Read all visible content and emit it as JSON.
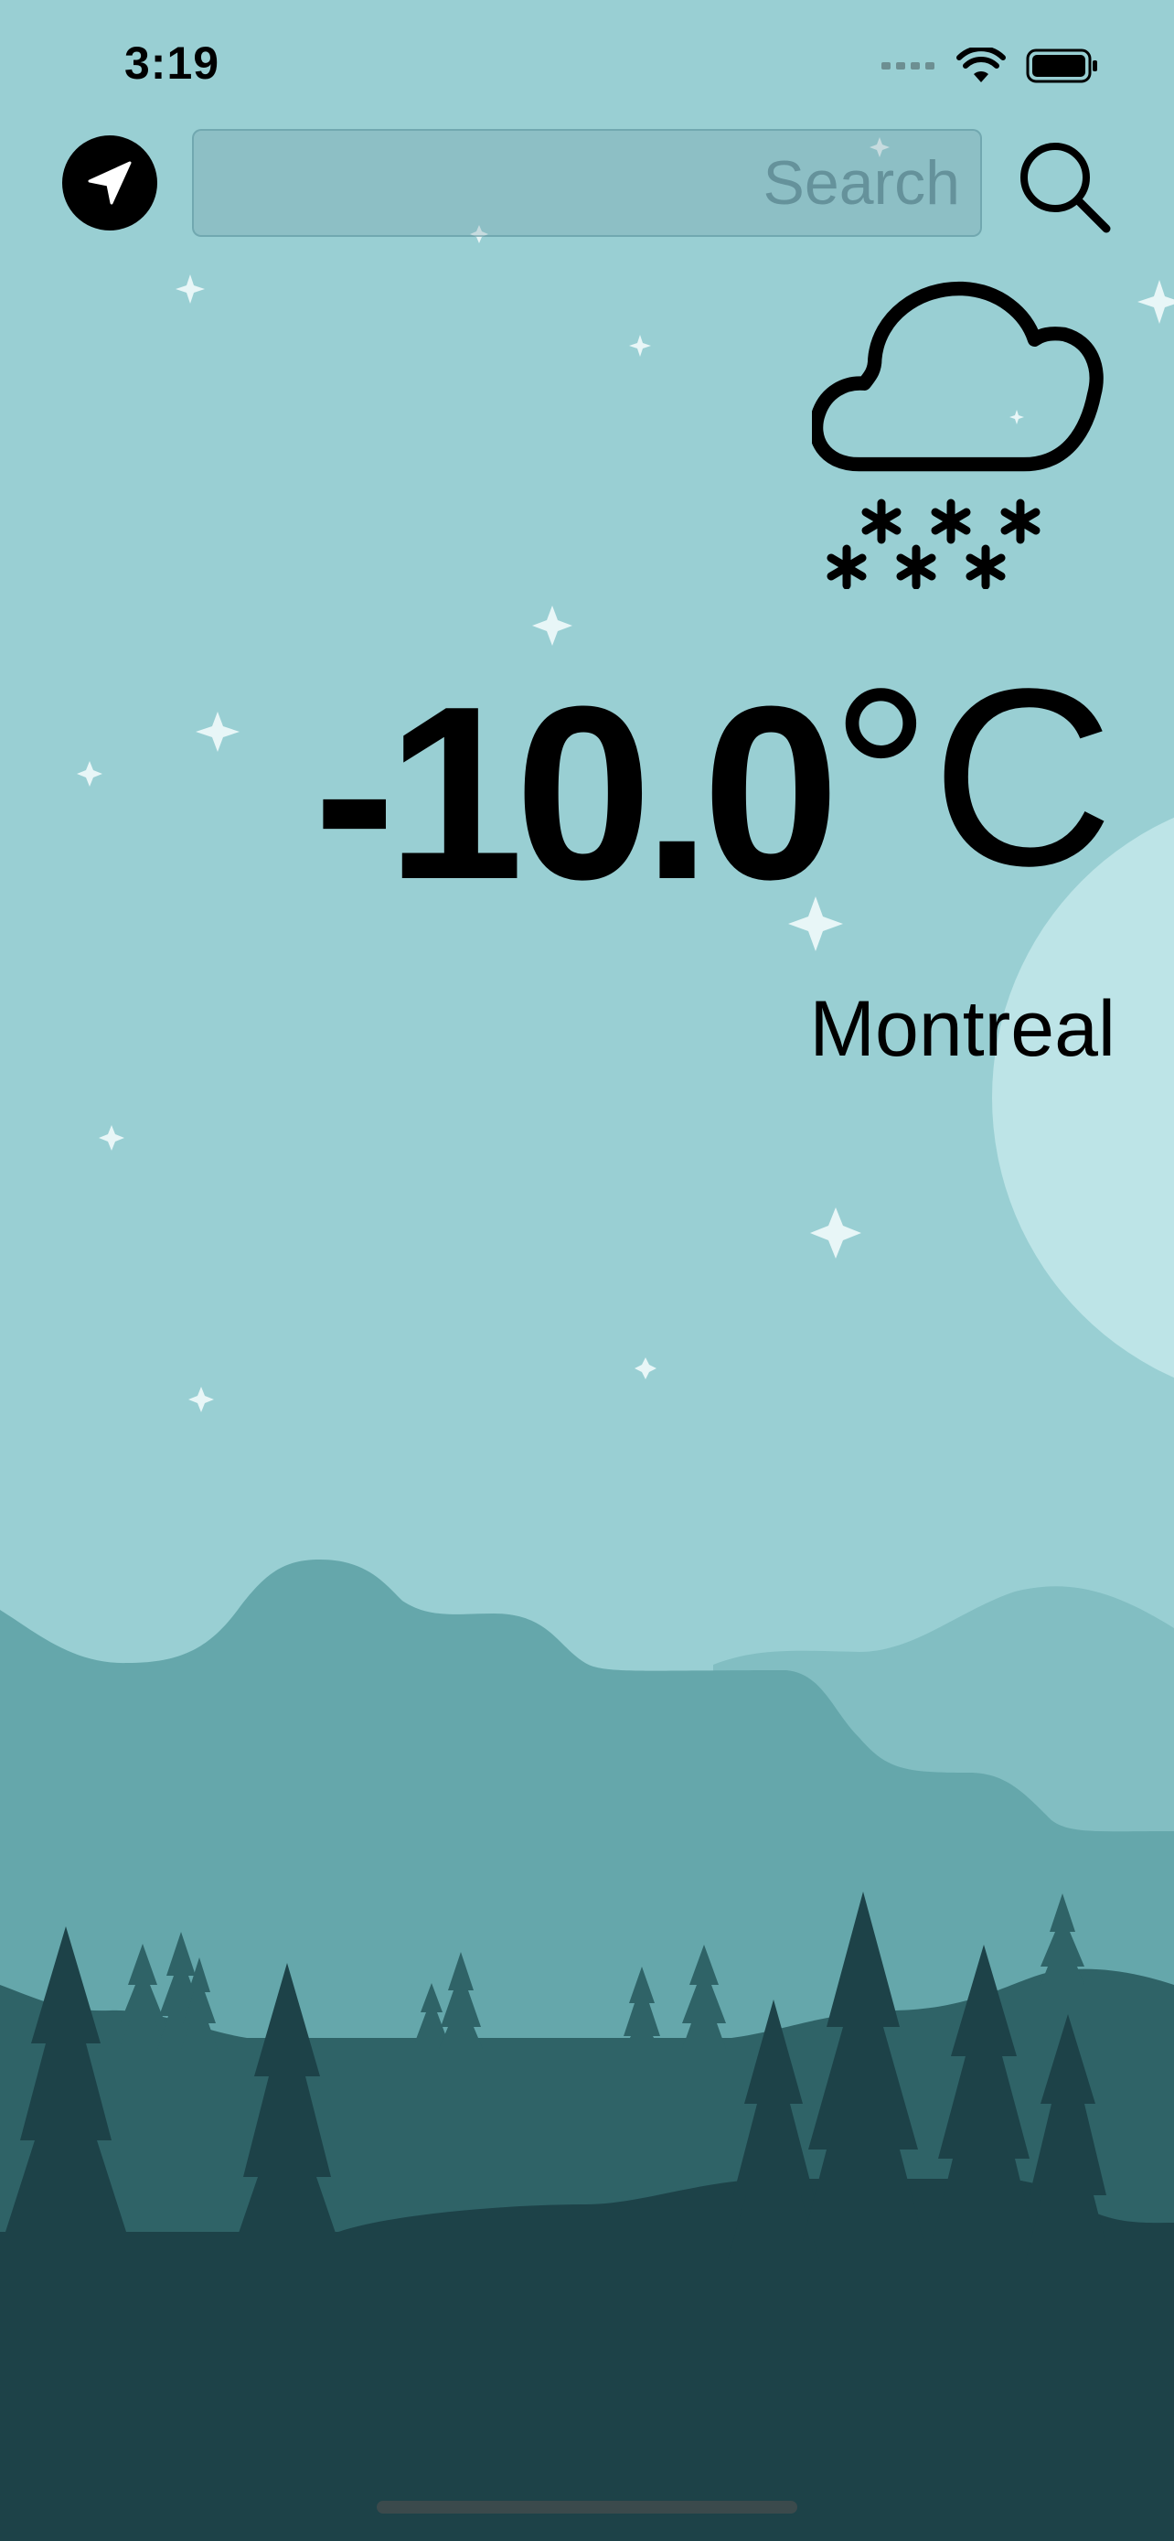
{
  "status_bar": {
    "time": "3:19",
    "icons": [
      "cellular-signal-icon",
      "wifi-icon",
      "battery-icon"
    ]
  },
  "top_bar": {
    "location_icon": "location-arrow-icon",
    "search": {
      "placeholder": "Search",
      "value": ""
    },
    "search_icon": "magnifier-icon"
  },
  "weather": {
    "condition_icon": "cloud-snow-icon",
    "temperature": "-10.0",
    "unit": "°C",
    "city": "Montreal"
  },
  "theme": {
    "sky": "#99cfd3",
    "moon": "#bde4e7",
    "far_hills": "#82bec2",
    "mid_hills": "#65a7ab",
    "near_hills": "#2f6367",
    "foreground": "#1d4248",
    "stars": "#e8f6f7"
  }
}
